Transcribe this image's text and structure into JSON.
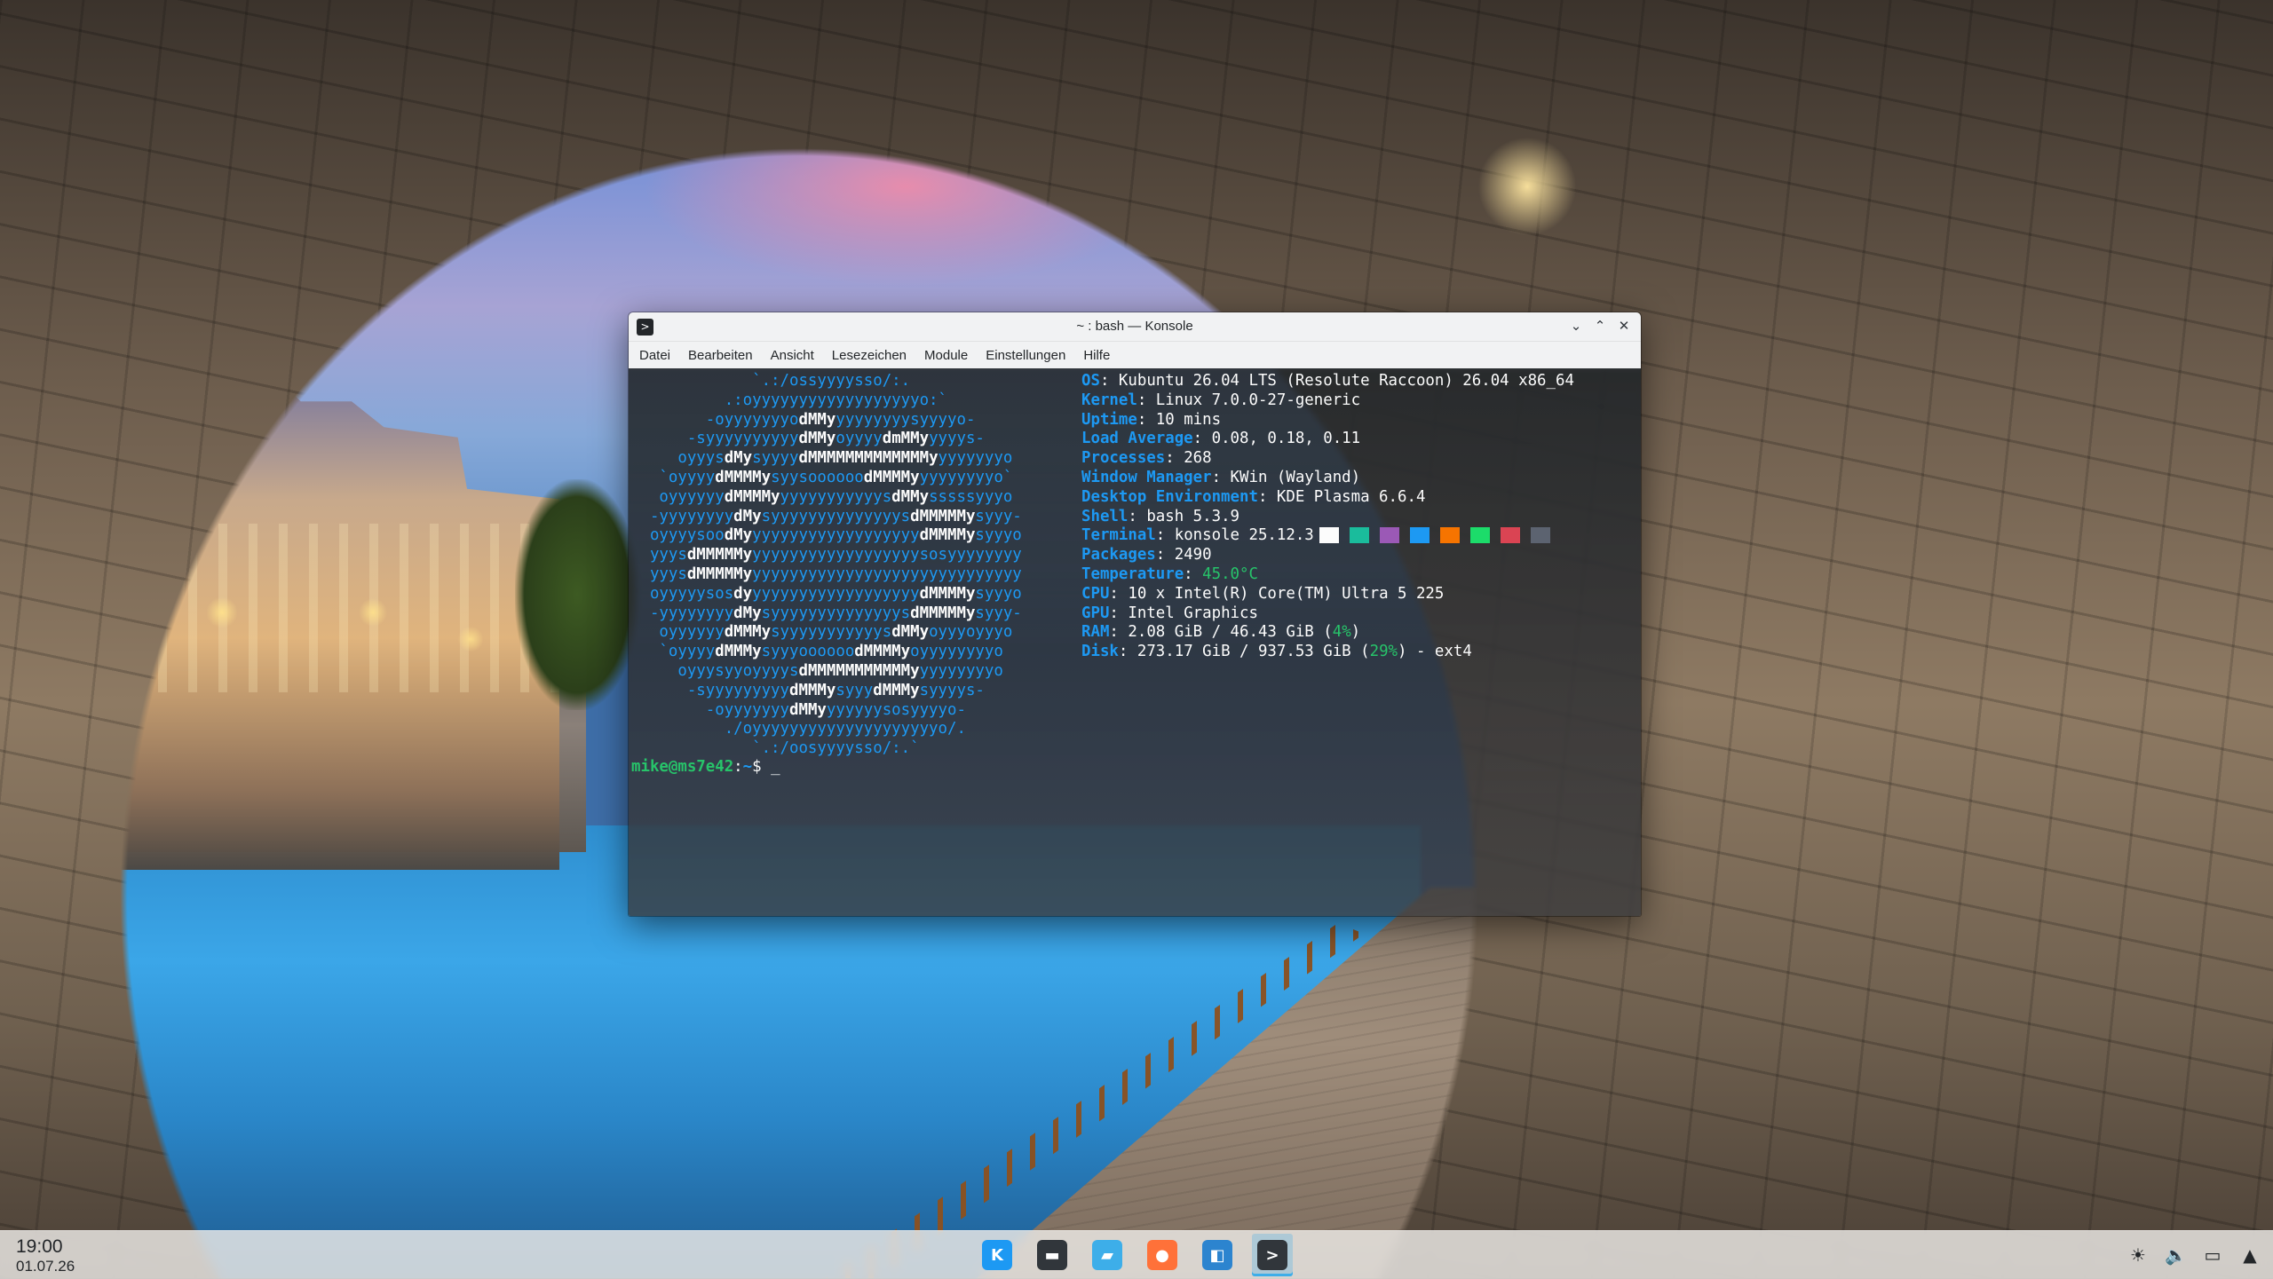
{
  "window": {
    "title": "~ : bash — Konsole",
    "app_icon": ">",
    "controls": {
      "minimize": "⌄",
      "maximize": "⌃",
      "close": "✕"
    },
    "menu": [
      "Datei",
      "Bearbeiten",
      "Ansicht",
      "Lesezeichen",
      "Module",
      "Einstellungen",
      "Hilfe"
    ]
  },
  "terminal": {
    "logo_lines": [
      [
        [
          "b",
          "             `.:/ossyyyysso/:."
        ]
      ],
      [
        [
          "b",
          "          .:oyyyyyyyyyyyyyyyyyyo:`"
        ]
      ],
      [
        [
          "b",
          "        -oyyyyyyyo"
        ],
        [
          "w",
          "dMMy"
        ],
        [
          "b",
          "yyyyyyyysyyyyo-"
        ]
      ],
      [
        [
          "b",
          "      -syyyyyyyyyy"
        ],
        [
          "w",
          "dMMy"
        ],
        [
          "b",
          "oyyyy"
        ],
        [
          "w",
          "dmMMy"
        ],
        [
          "b",
          "yyyys-"
        ]
      ],
      [
        [
          "b",
          "     oyyys"
        ],
        [
          "w",
          "dMy"
        ],
        [
          "b",
          "syyyy"
        ],
        [
          "w",
          "dMMMMMMMMMMMMMy"
        ],
        [
          "b",
          "yyyyyyyo"
        ]
      ],
      [
        [
          "b",
          "   `oyyyy"
        ],
        [
          "w",
          "dMMMMy"
        ],
        [
          "b",
          "syysoooooo"
        ],
        [
          "w",
          "dMMMMy"
        ],
        [
          "b",
          "yyyyyyyyo`"
        ]
      ],
      [
        [
          "b",
          "   oyyyyyy"
        ],
        [
          "w",
          "dMMMMy"
        ],
        [
          "b",
          "yyyyyyyyyyys"
        ],
        [
          "w",
          "dMMy"
        ],
        [
          "b",
          "sssssyyyo"
        ]
      ],
      [
        [
          "b",
          "  -yyyyyyyy"
        ],
        [
          "w",
          "dMy"
        ],
        [
          "b",
          "syyyyyyyyyyyyyys"
        ],
        [
          "w",
          "dMMMMMy"
        ],
        [
          "b",
          "syyy-"
        ]
      ],
      [
        [
          "b",
          "  oyyyysoo"
        ],
        [
          "w",
          "dMy"
        ],
        [
          "b",
          "yyyyyyyyyyyyyyyyyy"
        ],
        [
          "w",
          "dMMMMy"
        ],
        [
          "b",
          "syyyo"
        ]
      ],
      [
        [
          "b",
          "  yyys"
        ],
        [
          "w",
          "dMMMMMy"
        ],
        [
          "b",
          "yyyyyyyyyyyyyyyyyysosyyyyyyyy"
        ]
      ],
      [
        [
          "b",
          "  yyys"
        ],
        [
          "w",
          "dMMMMMy"
        ],
        [
          "b",
          "yyyyyyyyyyyyyyyyyyyyyyyyyyyyy"
        ]
      ],
      [
        [
          "b",
          "  oyyyyysos"
        ],
        [
          "w",
          "dy"
        ],
        [
          "b",
          "yyyyyyyyyyyyyyyyyy"
        ],
        [
          "w",
          "dMMMMy"
        ],
        [
          "b",
          "syyyo"
        ]
      ],
      [
        [
          "b",
          "  -yyyyyyyy"
        ],
        [
          "w",
          "dMy"
        ],
        [
          "b",
          "syyyyyyyyyyyyyys"
        ],
        [
          "w",
          "dMMMMMy"
        ],
        [
          "b",
          "syyy-"
        ]
      ],
      [
        [
          "b",
          "   oyyyyyy"
        ],
        [
          "w",
          "dMMMy"
        ],
        [
          "b",
          "syyyyyyyyyyys"
        ],
        [
          "w",
          "dMMy"
        ],
        [
          "b",
          "oyyyoyyyo"
        ]
      ],
      [
        [
          "b",
          "   `oyyyy"
        ],
        [
          "w",
          "dMMMy"
        ],
        [
          "b",
          "syyyoooooo"
        ],
        [
          "w",
          "dMMMMy"
        ],
        [
          "b",
          "oyyyyyyyyo"
        ]
      ],
      [
        [
          "b",
          "     oyyysyyoyyyys"
        ],
        [
          "w",
          "dMMMMMMMMMMMy"
        ],
        [
          "b",
          "yyyyyyyyo"
        ]
      ],
      [
        [
          "b",
          "      -syyyyyyyyy"
        ],
        [
          "w",
          "dMMMy"
        ],
        [
          "b",
          "syyy"
        ],
        [
          "w",
          "dMMMy"
        ],
        [
          "b",
          "syyyys-"
        ]
      ],
      [
        [
          "b",
          "        -oyyyyyyy"
        ],
        [
          "w",
          "dMMy"
        ],
        [
          "b",
          "yyyyyysosyyyyo-"
        ]
      ],
      [
        [
          "b",
          "          ./oyyyyyyyyyyyyyyyyyyyyo/."
        ]
      ],
      [
        [
          "b",
          "             `.:/oosyyyysso/:.`"
        ]
      ]
    ],
    "info": [
      {
        "key": "OS",
        "value": "Kubuntu 26.04 LTS (Resolute Raccoon) 26.04 x86_64"
      },
      {
        "key": "Kernel",
        "value": "Linux 7.0.0-27-generic"
      },
      {
        "key": "Uptime",
        "value": "10 mins"
      },
      {
        "key": "Load Average",
        "value": "0.08, 0.18, 0.11"
      },
      {
        "key": "Processes",
        "value": "268"
      },
      {
        "key": "Window Manager",
        "value": "KWin (Wayland)"
      },
      {
        "key": "Desktop Environment",
        "value": "KDE Plasma 6.6.4"
      },
      {
        "key": "Shell",
        "value": "bash 5.3.9"
      },
      {
        "key": "Terminal",
        "value": "konsole 25.12.3"
      },
      {
        "key": "Packages",
        "value": "2490"
      },
      {
        "key": "Temperature",
        "value": "45.0°C"
      },
      {
        "key": "CPU",
        "value": "10 x Intel(R) Core(TM) Ultra 5 225"
      },
      {
        "key": "GPU",
        "value": "Intel Graphics"
      },
      {
        "key": "RAM",
        "value": "2.08 GiB / 46.43 GiB (",
        "percent": "4%",
        "suffix": ")"
      },
      {
        "key": "Disk",
        "value": "273.17 GiB / 937.53 GiB (",
        "percent": "29%",
        "suffix": ") - ext4"
      }
    ],
    "color_swatches": [
      "#fcfcfc",
      "#1abc9c",
      "#9b59b6",
      "#1d99f3",
      "#f67400",
      "#1cdc6a",
      "#da4453",
      "#5c6370"
    ],
    "prompt": {
      "user_host": "mike@ms7e42",
      "separator": ":",
      "path": "~",
      "symbol": "$ ",
      "cursor": "_"
    }
  },
  "taskbar": {
    "clock_time": "19:00",
    "clock_date": "01.07.26",
    "tasks": [
      {
        "name": "kde-launcher-icon",
        "glyph": "K",
        "color": "#1d99f3"
      },
      {
        "name": "system-settings-icon",
        "glyph": "▬",
        "color": "#31363b"
      },
      {
        "name": "dolphin-file-manager-icon",
        "glyph": "▰",
        "color": "#3daee9"
      },
      {
        "name": "firefox-icon",
        "glyph": "●",
        "color": "#ff7139"
      },
      {
        "name": "discover-store-icon",
        "glyph": "◧",
        "color": "#2c84cf"
      },
      {
        "name": "konsole-icon",
        "glyph": ">",
        "color": "#31363b"
      }
    ],
    "tray": [
      {
        "name": "brightness-icon",
        "glyph": "☀"
      },
      {
        "name": "volume-icon",
        "glyph": "🔈"
      },
      {
        "name": "display-icon",
        "glyph": "▭"
      },
      {
        "name": "tray-expand-icon",
        "glyph": "▲"
      }
    ]
  }
}
